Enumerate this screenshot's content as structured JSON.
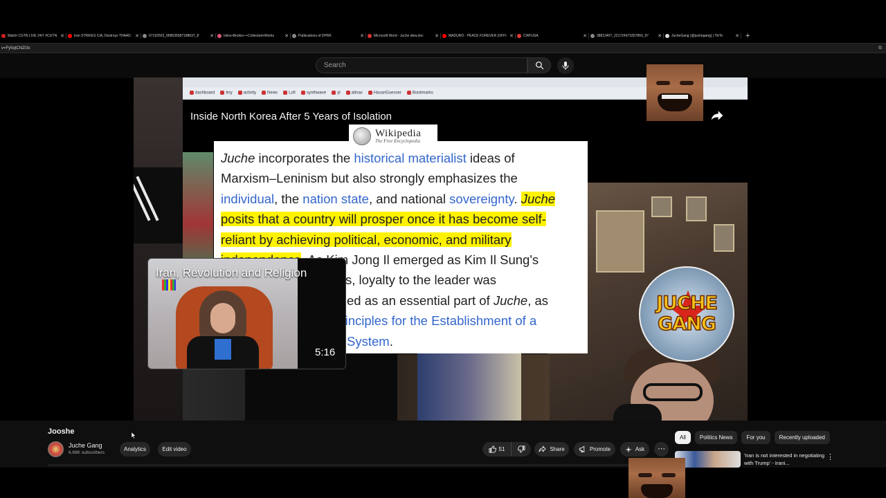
{
  "browser": {
    "tabs": [
      {
        "title": "Watch CGTN LIVE 24/7 #CGTN",
        "color": "#cc2222",
        "width": 96
      },
      {
        "title": "Iran STRIKES CIA, Destroys THAAD",
        "color": "#ff0000",
        "width": 108
      },
      {
        "title": "67192503_968536587188637_8",
        "color": "#888888",
        "width": 108
      },
      {
        "title": "Iskra+Books+-+Collected+Works",
        "color": "#e05577",
        "width": 108
      },
      {
        "title": "Publications of DPRK",
        "color": "#888888",
        "width": 109
      },
      {
        "title": "Microsoft Word - Juche idea.doc",
        "color": "#dd3333",
        "width": 108
      },
      {
        "title": "MADURO - PEACE FOREVER (OFFI",
        "color": "#ff0000",
        "width": 108
      },
      {
        "title": "CWFUSA",
        "color": "#e33b3b",
        "width": 106
      },
      {
        "title": "38813407_221724971857860_97",
        "color": "#888888",
        "width": 108
      },
      {
        "title": "JucheGang (@juchegang) | TikTo",
        "color": "#dddddd",
        "width": 112
      }
    ],
    "new_tab_label": "+",
    "address": "v=Fy5qtCNZI3c",
    "extension_icon": "extension-icon"
  },
  "youtube": {
    "search_placeholder": "Search",
    "search_icon": "search-icon",
    "mic_icon": "mic-icon"
  },
  "video_frame": {
    "inner_title": "Inside North Korea After 5 Years of Isolation",
    "inner_bookmarks": [
      "dashboard",
      "tiny",
      "activity",
      "News",
      "Lofi",
      "synthwave",
      "yt",
      "altnav",
      "HasanGuesser",
      "Bookmarks"
    ],
    "wiki_logo_word": "Wikipedia",
    "wiki_logo_sub": "The Free Encyclopedia",
    "wiki_lines": [
      [
        {
          "t": "Juche",
          "s": "i"
        },
        {
          "t": " incorporates the "
        },
        {
          "t": "historical materialist",
          "s": "l"
        },
        {
          "t": " ideas of"
        }
      ],
      [
        {
          "t": "Marxism–Leninism but also strongly emphasizes the"
        }
      ],
      [
        {
          "t": "individual",
          "s": "l"
        },
        {
          "t": ", the "
        },
        {
          "t": "nation state",
          "s": "l"
        },
        {
          "t": ", and national "
        },
        {
          "t": "sovereignty",
          "s": "l"
        },
        {
          "t": ". "
        },
        {
          "t": "Juche",
          "s": "hi"
        }
      ],
      [
        {
          "t": "posits that a country will prosper once it has become self-",
          "s": "h"
        }
      ],
      [
        {
          "t": "reliant by achieving political, economic, and military",
          "s": "h"
        }
      ],
      [
        {
          "t": "independence",
          "s": "h"
        },
        {
          "t": ". As Kim Jong Il emerged as Kim Il Sung's"
        }
      ],
      [
        {
          "t": "successor in the 1970s, loyalty to the leader was"
        }
      ],
      [
        {
          "t": "increasingly emphasized as an essential part of "
        },
        {
          "t": "Juche",
          "s": "i"
        },
        {
          "t": ", as"
        }
      ],
      [
        {
          "t": "reflected in the "
        },
        {
          "t": "Ten Principles for the Establishment of a",
          "s": "l"
        }
      ],
      [
        {
          "t": "Monolithic Ideological System",
          "s": "l"
        },
        {
          "t": "."
        }
      ]
    ],
    "badge_line1": "JUCHE",
    "badge_line2": "GANG"
  },
  "miniplayer": {
    "title": "Iran, Revolution and Religion",
    "duration": "5:16"
  },
  "video": {
    "title": "Jooshe",
    "channel": "Juche Gang",
    "subscribers": "6.68K subscribers",
    "analytics_label": "Analytics",
    "edit_label": "Edit video",
    "likes": "51",
    "share_label": "Share",
    "promote_label": "Promote",
    "ask_label": "Ask",
    "more_icon": "more-horizontal-icon"
  },
  "sidebar": {
    "chips": [
      {
        "label": "All",
        "active": true
      },
      {
        "label": "Politics News",
        "active": false
      },
      {
        "label": "For you",
        "active": false
      },
      {
        "label": "Recently uploaded",
        "active": false
      }
    ],
    "rec_title": "'Iran is not interested in negotiating with Trump' - Irani..."
  }
}
